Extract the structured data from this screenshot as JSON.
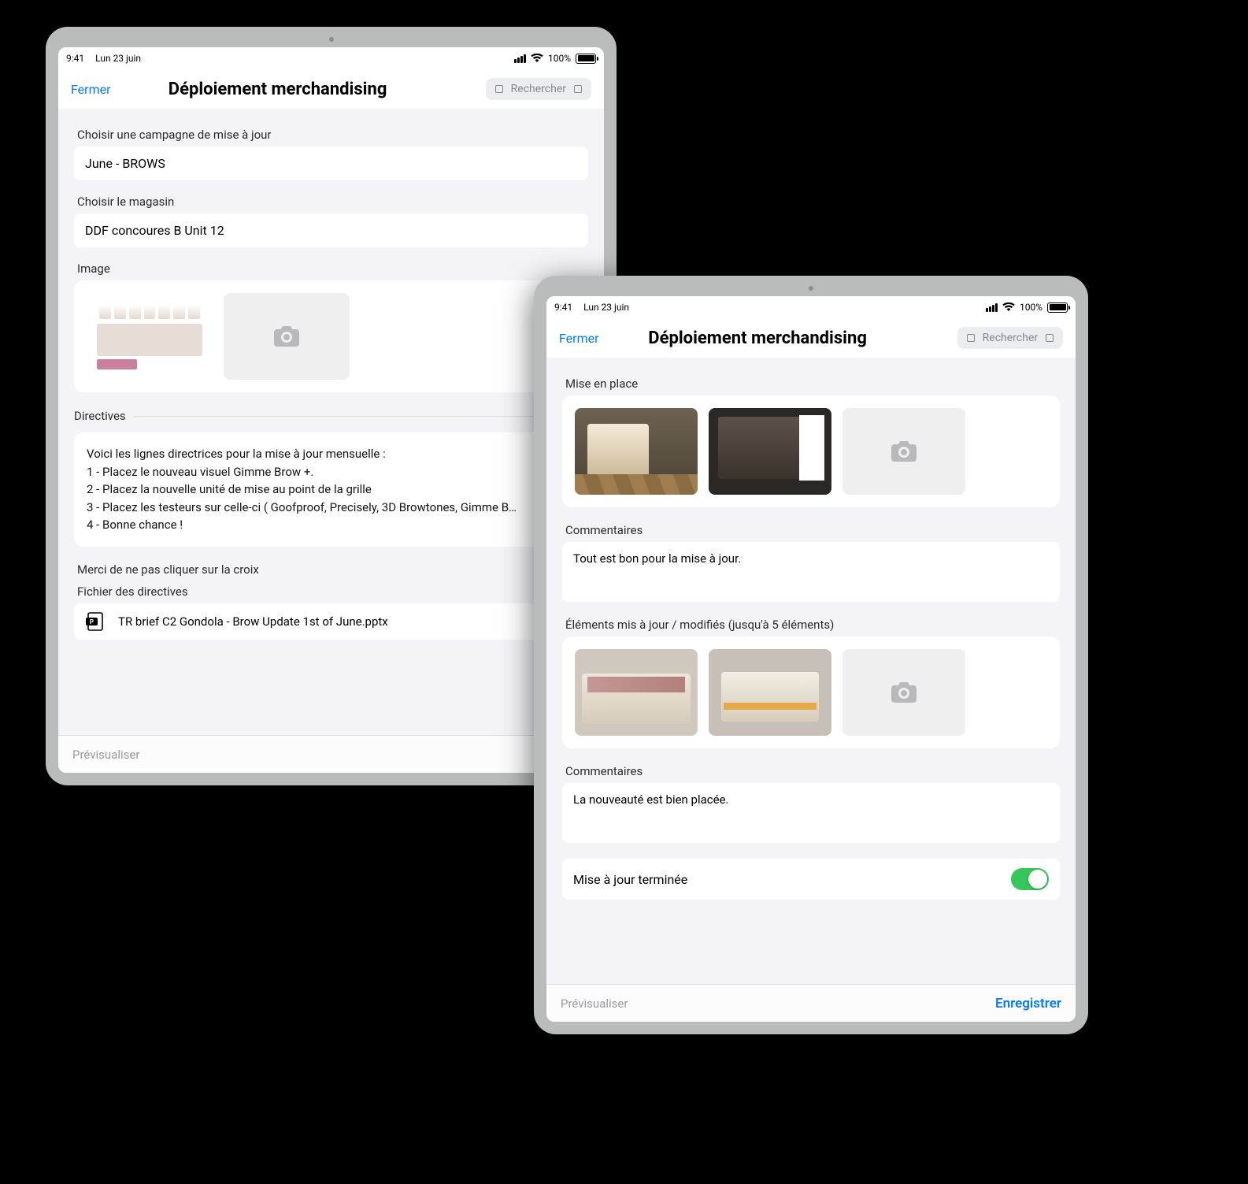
{
  "status": {
    "time": "9:41",
    "date": "Lun 23 juin",
    "battery_pct": "100%"
  },
  "nav": {
    "close": "Fermer",
    "title": "Déploiement merchandising",
    "search_placeholder": "Rechercher"
  },
  "screen1": {
    "campaign_label": "Choisir une campagne de mise à jour",
    "campaign_value": "June - BROWS",
    "store_label": "Choisir le magasin",
    "store_value": "DDF concoures B Unit 12",
    "image_label": "Image",
    "directives_label": "Directives",
    "directives_intro": "Voici les lignes directrices pour la mise à jour mensuelle :",
    "directives_lines": [
      "1 - Placez le nouveau visuel Gimme Brow +.",
      "2 - Placez la nouvelle unité de mise au point de la grille",
      "3 - Placez les testeurs sur celle-ci ( Goofproof, Precisely, 3D Browtones, Gimme B…",
      "4 - Bonne chance !"
    ],
    "dont_click_note": "Merci de ne pas cliquer sur la croix",
    "file_label": "Fichier des directives",
    "file_name": "TR brief C2 Gondola - Brow Update 1st of June.pptx"
  },
  "screen2": {
    "setup_label": "Mise en place",
    "comments_label": "Commentaires",
    "comment1": "Tout est bon pour la mise à jour.",
    "updated_label": "Éléments mis à jour / modifiés (jusqu'à 5 éléments)",
    "comment2": "La nouveauté est bien placée.",
    "done_label": "Mise à jour terminée"
  },
  "footer": {
    "preview": "Prévisualiser",
    "save": "Enregistrer"
  }
}
